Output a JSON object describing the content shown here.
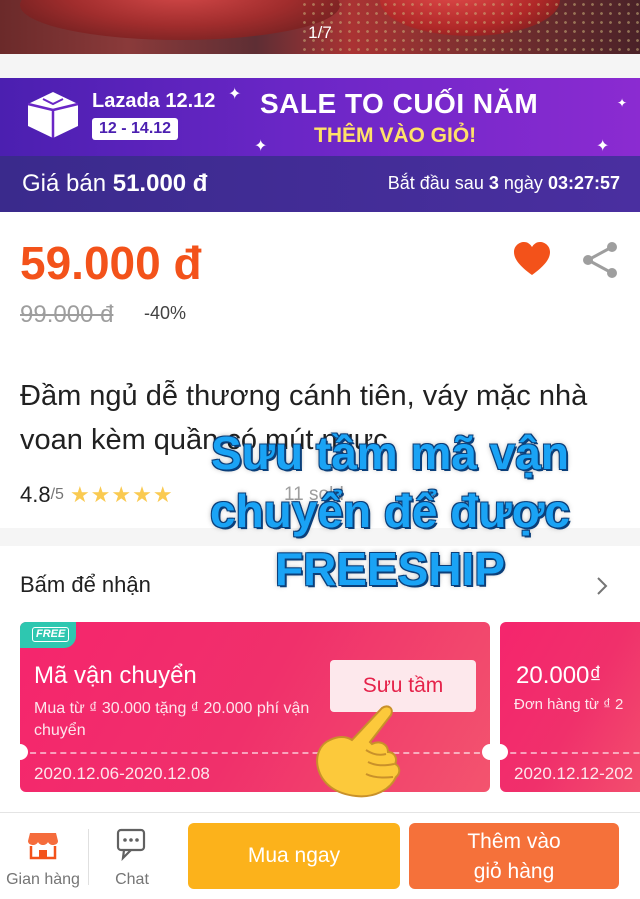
{
  "gallery": {
    "counter": "1/7"
  },
  "banner": {
    "brand": "Lazada 12.12",
    "dates": "12 - 14.12",
    "headline": "SALE TO CUỐI NĂM",
    "subheadline": "THÊM VÀO GIỎ!",
    "sale_price_label": "Giá bán",
    "sale_price": "51.000 đ",
    "countdown_prefix": "Bắt đầu sau",
    "countdown_days": "3",
    "countdown_unit": "ngày",
    "countdown_time": "03:27:57"
  },
  "product": {
    "price": "59.000 đ",
    "original_price": "99.000 đ",
    "discount": "-40%",
    "title": "Đầm ngủ dễ thương cánh tiên, váy mặc nhà voan kèm quần có mút ngực",
    "rating": "4.8",
    "rating_max": "/5",
    "rating_value": 4.8,
    "sold": "11 sold"
  },
  "collect": {
    "heading": "Bấm để nhận"
  },
  "vouchers": [
    {
      "tag": "FREE",
      "title": "Mã vận chuyển",
      "description": "Mua từ ₫ 30.000 tặng ₫ 20.000 phí vận chuyển",
      "button": "Sưu tầm",
      "dates": "2020.12.06-2020.12.08"
    },
    {
      "title": "20.000₫",
      "description": "Đơn hàng từ ₫ 2",
      "dates": "2020.12.12-202"
    }
  ],
  "overlay": {
    "line1": "Sưu tầm mã vận",
    "line2": "chuyển để được",
    "line3": "FREESHIP"
  },
  "bottom_bar": {
    "store": "Gian hàng",
    "chat": "Chat",
    "buy_now": "Mua ngay",
    "add_to_cart_line1": "Thêm vào",
    "add_to_cart_line2": "giỏ hàng"
  },
  "colors": {
    "price": "#f3521a",
    "voucher": "#f5256d",
    "buy_now": "#fcb21b",
    "add_to_cart": "#f5713a",
    "banner": "#6a26c6"
  },
  "icons": [
    "heart-icon",
    "share-icon",
    "chevron-right-icon",
    "store-icon",
    "chat-icon",
    "pointing-hand-emoji",
    "lazada-logo"
  ]
}
